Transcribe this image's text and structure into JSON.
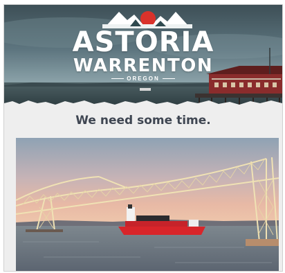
{
  "banner": {
    "logo_line1": "ASTORIA",
    "logo_line2": "WARRENTON",
    "logo_line3": "OREGON"
  },
  "message": {
    "heading": "We need some time."
  },
  "colors": {
    "heading_text": "#3f4652",
    "page_background": "#eeeeee",
    "ship_hull": "#d8252a",
    "sky_top": "#8fa2b4",
    "sky_horizon": "#e8b9a5"
  }
}
